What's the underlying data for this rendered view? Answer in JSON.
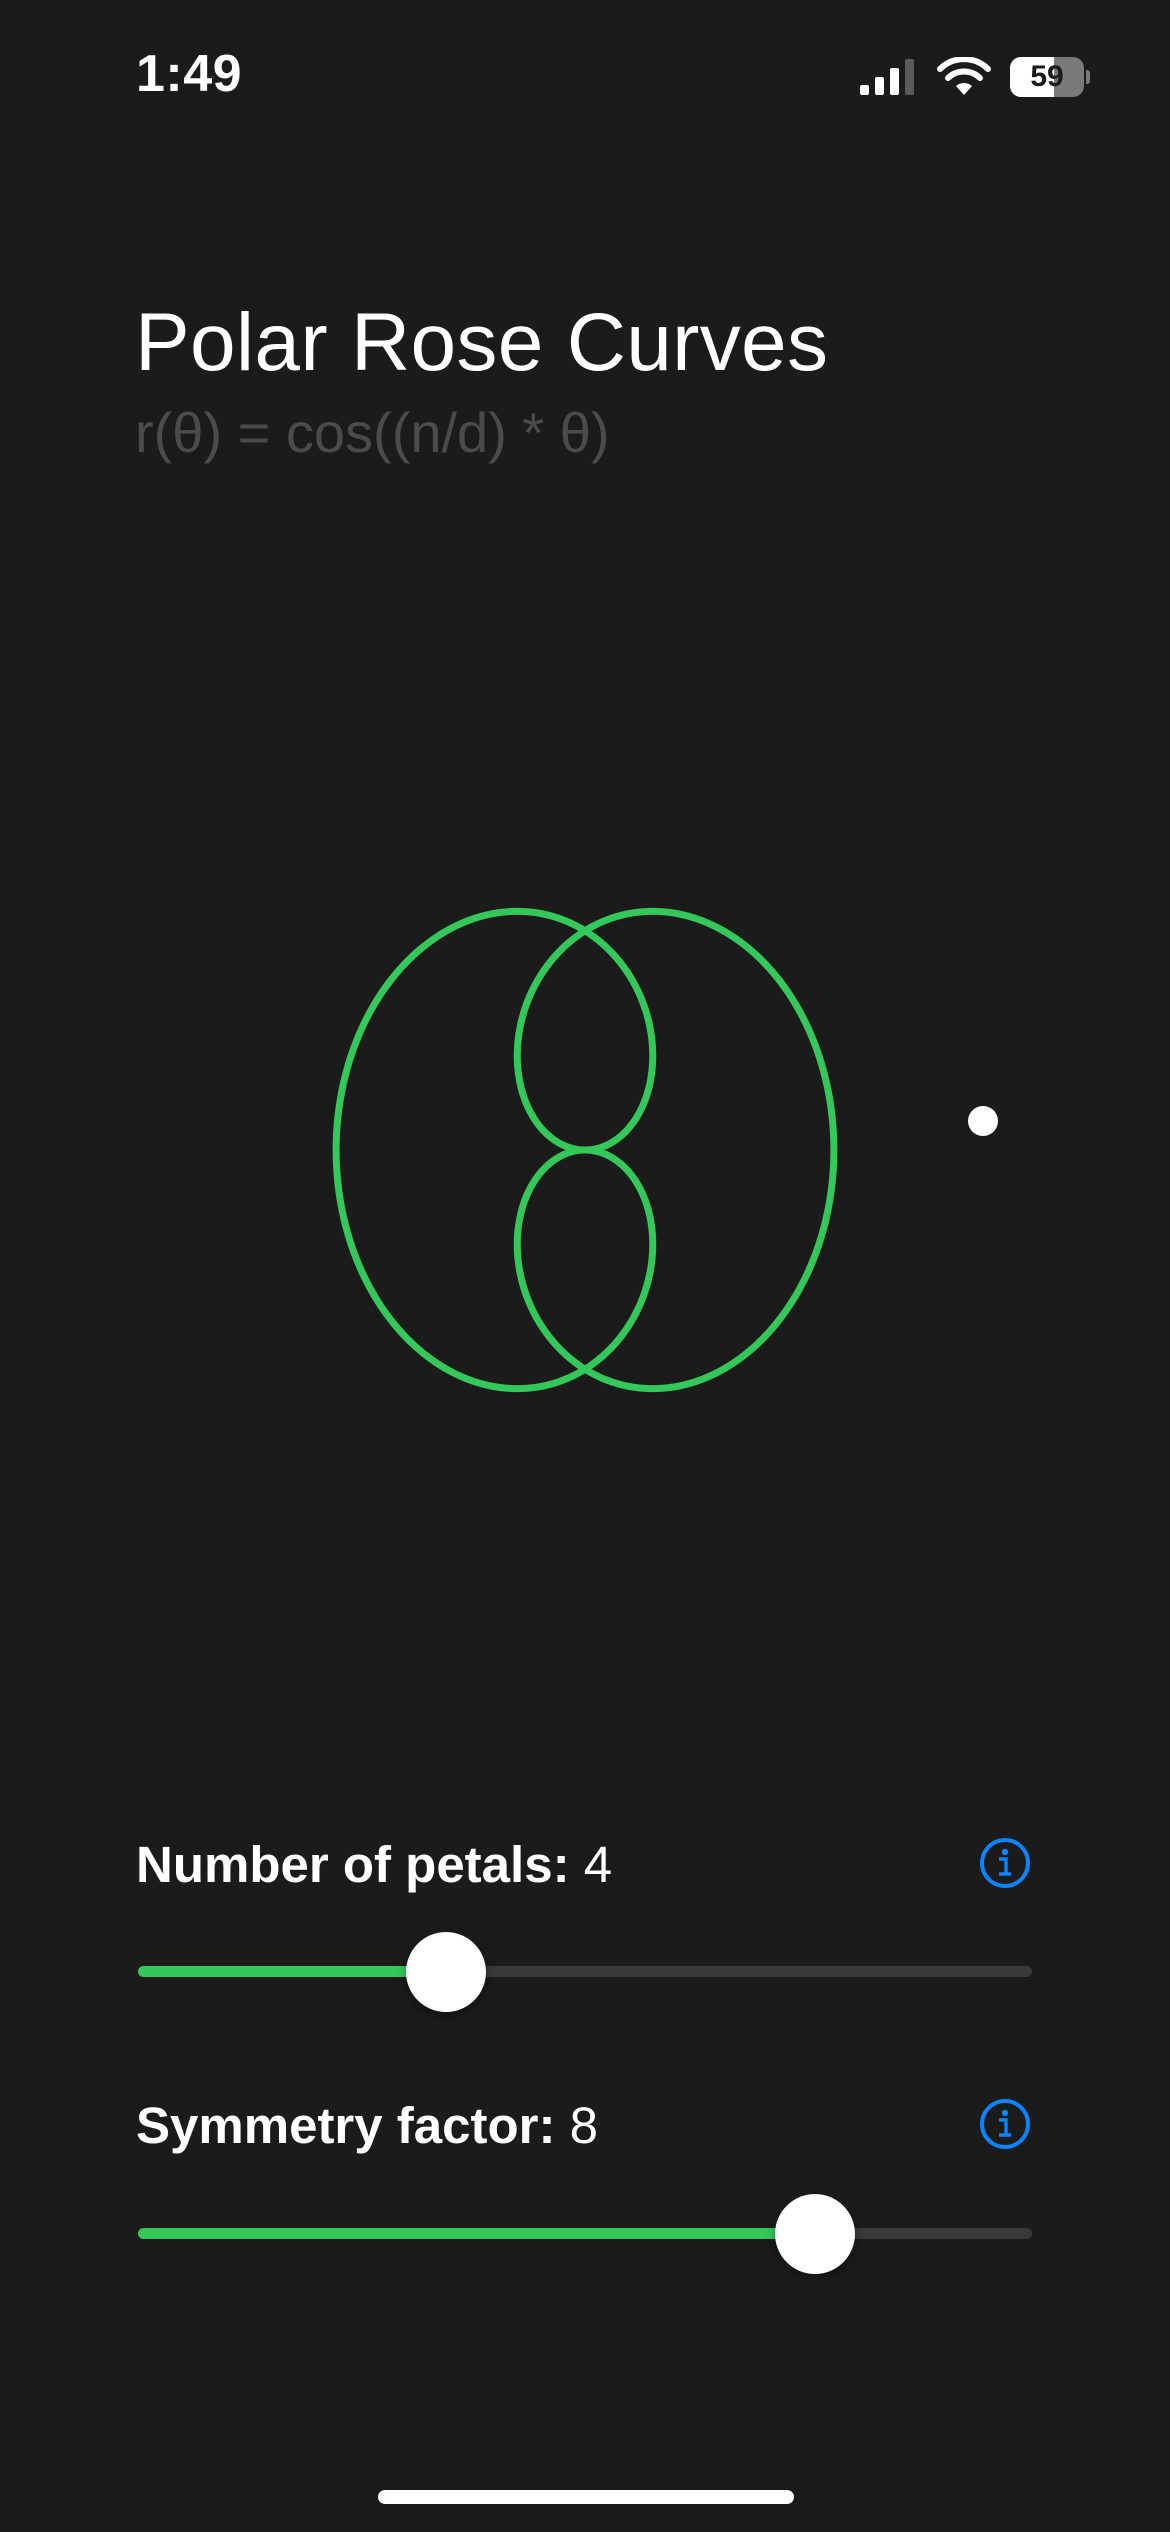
{
  "status_bar": {
    "time": "1:49",
    "battery": "59",
    "icons": [
      "signal-icon",
      "wifi-icon",
      "battery-icon"
    ]
  },
  "header": {
    "title": "Polar Rose Curves",
    "formula": "r(θ) = cos((n/d) * θ)"
  },
  "controls": {
    "petals": {
      "label": "Number of petals:",
      "value": "4",
      "fill_fraction": 0.345
    },
    "symmetry": {
      "label": "Symmetry factor:",
      "value": "8",
      "fill_fraction": 0.757
    }
  },
  "colors": {
    "background": "#1b1b1b",
    "curve": "#34c759",
    "accent_info": "#0a84ff",
    "slider_fill": "#34c759",
    "slider_track": "#3a3a3a"
  }
}
